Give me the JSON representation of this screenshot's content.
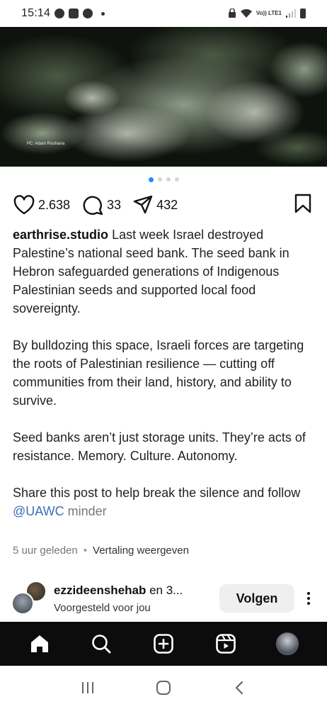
{
  "status_bar": {
    "time": "15:14",
    "network": "Vo)) LTE1"
  },
  "photo": {
    "credit": "PC: Adam Rouhana",
    "carousel_count": 4,
    "carousel_active": 1
  },
  "actions": {
    "likes": "2.638",
    "comments": "33",
    "shares": "432"
  },
  "caption": {
    "username": "earthrise.studio",
    "paragraph1": "Last week Israel destroyed Palestine’s national seed bank. The seed bank in Hebron safeguarded generations of Indigenous Palestinian seeds and supported local food sovereignty.",
    "paragraph2": "By bulldozing this space, Israeli forces are targeting the roots of Palestinian resilience — cutting off communities from their land, history, and ability to survive.",
    "paragraph3": "Seed banks aren’t just storage units. They’re acts of resistance. Memory. Culture. Autonomy.",
    "paragraph4": "Share this post to help break the silence and follow",
    "mention": "@UAWC",
    "less_label": "minder"
  },
  "meta": {
    "time_ago": "5 uur geleden",
    "separator": "•",
    "translate": "Vertaling weergeven"
  },
  "suggested": {
    "username": "ezzideenshehab",
    "suffix": " en 3...",
    "subtitle": "Voorgesteld voor jou",
    "follow_label": "Volgen"
  },
  "colors": {
    "accent_dot": "#1a8cff",
    "mention": "#3b6fb5",
    "tabbar_bg": "#0c0c0c"
  },
  "icons": {
    "status": [
      "whatsapp-icon",
      "photo-icon",
      "pinterest-icon"
    ],
    "tabs": [
      "home-icon",
      "search-icon",
      "create-icon",
      "reels-icon",
      "profile-avatar"
    ],
    "nav": [
      "recents-icon",
      "home-circle-icon",
      "back-icon"
    ]
  }
}
